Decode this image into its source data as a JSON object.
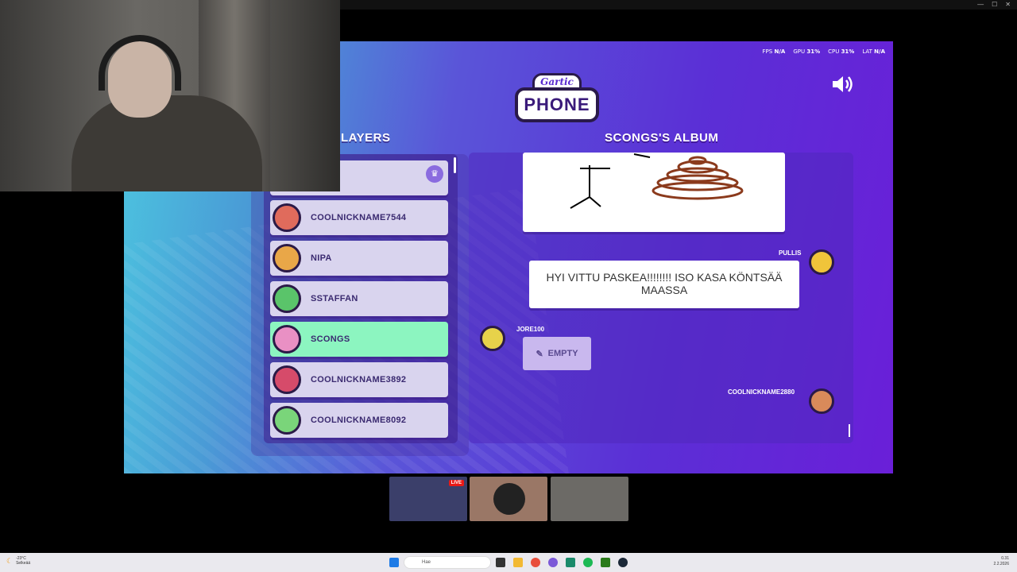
{
  "stats": {
    "fps_label": "FPS",
    "fps_value": "N/A",
    "gpu_label": "GPU",
    "gpu_value": "31%",
    "cpu_label": "CPU",
    "cpu_value": "31%",
    "lat_label": "LAT",
    "lat_value": "N/A"
  },
  "logo": {
    "top": "Gartic",
    "bottom": "PHONE"
  },
  "players_title": "LAYERS",
  "album_title": "SCONGS'S ALBUM",
  "players": [
    {
      "name": "",
      "color": "#d9d4ee",
      "avatar_color": "#c77bd8"
    },
    {
      "name": "COOLNICKNAME7544",
      "avatar_color": "#e06b5c"
    },
    {
      "name": "NIPA",
      "avatar_color": "#e9a748"
    },
    {
      "name": "SSTAFFAN",
      "avatar_color": "#5ac46a"
    },
    {
      "name": "SCONGS",
      "avatar_color": "#e990c4",
      "active": true
    },
    {
      "name": "COOLNICKNAME3892",
      "avatar_color": "#d64b6a"
    },
    {
      "name": "COOLNICKNAME8092",
      "avatar_color": "#7ad57a"
    }
  ],
  "album": {
    "pullis_name": "PULLIS",
    "message": "HYI VITTU PASKEA!!!!!!!! ISO KASA KÖNTSÄÄ MAASSA",
    "jore_name": "JORE100",
    "empty_label": "EMPTY",
    "cool_name": "COOLNICKNAME2880"
  },
  "thumbs": {
    "live_label": "LIVE"
  },
  "taskbar": {
    "temp": "-23°C",
    "weather": "Selkeää",
    "search_placeholder": "Hae",
    "time": "0.31",
    "date": "2.2.2026"
  },
  "colors": {
    "active_row": "#8cf5c0",
    "row": "#d9d4ee",
    "panel": "#5b2fd6"
  }
}
